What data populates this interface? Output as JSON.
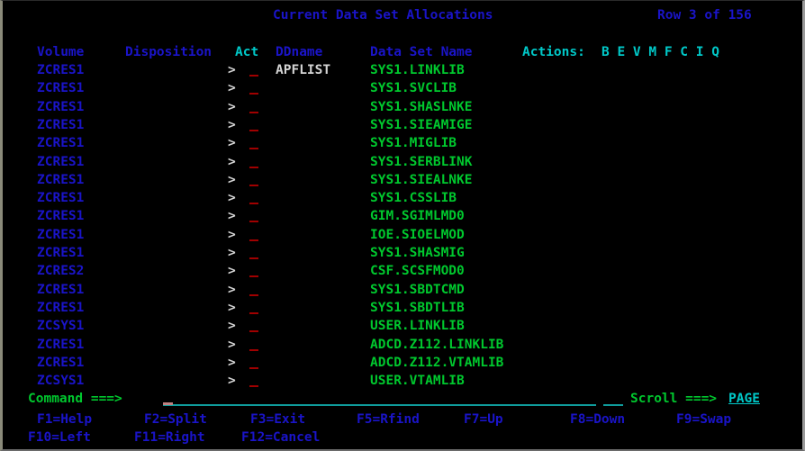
{
  "screen": {
    "title": "Current Data Set Allocations",
    "row_indicator": "Row 3 of 156",
    "colors": {
      "background": "#000000",
      "heading": "#1a14c8",
      "highlight": "#00c8c8",
      "data": "#00c82e",
      "input_marker": "#b00000",
      "neutral": "#d4d4d4"
    }
  },
  "columns": {
    "volume": "Volume",
    "disposition": "Disposition",
    "act": "Act",
    "ddname": "DDname",
    "data_set_name": "Data Set Name",
    "actions_label": "Actions:",
    "actions_keys": "B E V M F C I Q"
  },
  "rows": [
    {
      "volume": "ZCRES1",
      "disposition": ">",
      "act": "_",
      "ddname": "APFLIST",
      "dsn": "SYS1.LINKLIB"
    },
    {
      "volume": "ZCRES1",
      "disposition": ">",
      "act": "_",
      "ddname": "",
      "dsn": "SYS1.SVCLIB"
    },
    {
      "volume": "ZCRES1",
      "disposition": ">",
      "act": "_",
      "ddname": "",
      "dsn": "SYS1.SHASLNKE"
    },
    {
      "volume": "ZCRES1",
      "disposition": ">",
      "act": "_",
      "ddname": "",
      "dsn": "SYS1.SIEAMIGE"
    },
    {
      "volume": "ZCRES1",
      "disposition": ">",
      "act": "_",
      "ddname": "",
      "dsn": "SYS1.MIGLIB"
    },
    {
      "volume": "ZCRES1",
      "disposition": ">",
      "act": "_",
      "ddname": "",
      "dsn": "SYS1.SERBLINK"
    },
    {
      "volume": "ZCRES1",
      "disposition": ">",
      "act": "_",
      "ddname": "",
      "dsn": "SYS1.SIEALNKE"
    },
    {
      "volume": "ZCRES1",
      "disposition": ">",
      "act": "_",
      "ddname": "",
      "dsn": "SYS1.CSSLIB"
    },
    {
      "volume": "ZCRES1",
      "disposition": ">",
      "act": "_",
      "ddname": "",
      "dsn": "GIM.SGIMLMD0"
    },
    {
      "volume": "ZCRES1",
      "disposition": ">",
      "act": "_",
      "ddname": "",
      "dsn": "IOE.SIOELMOD"
    },
    {
      "volume": "ZCRES1",
      "disposition": ">",
      "act": "_",
      "ddname": "",
      "dsn": "SYS1.SHASMIG"
    },
    {
      "volume": "ZCRES2",
      "disposition": ">",
      "act": "_",
      "ddname": "",
      "dsn": "CSF.SCSFMOD0"
    },
    {
      "volume": "ZCRES1",
      "disposition": ">",
      "act": "_",
      "ddname": "",
      "dsn": "SYS1.SBDTCMD"
    },
    {
      "volume": "ZCRES1",
      "disposition": ">",
      "act": "_",
      "ddname": "",
      "dsn": "SYS1.SBDTLIB"
    },
    {
      "volume": "ZCSYS1",
      "disposition": ">",
      "act": "_",
      "ddname": "",
      "dsn": "USER.LINKLIB"
    },
    {
      "volume": "ZCRES1",
      "disposition": ">",
      "act": "_",
      "ddname": "",
      "dsn": "ADCD.Z112.LINKLIB"
    },
    {
      "volume": "ZCRES1",
      "disposition": ">",
      "act": "_",
      "ddname": "",
      "dsn": "ADCD.Z112.VTAMLIB"
    },
    {
      "volume": "ZCSYS1",
      "disposition": ">",
      "act": "_",
      "ddname": "",
      "dsn": "USER.VTAMLIB"
    }
  ],
  "command_line": {
    "label": "Command ===>",
    "value": "",
    "scroll_label": "Scroll ===>",
    "scroll_value": "PAGE"
  },
  "function_keys": [
    {
      "key": "F1=Help"
    },
    {
      "key": "F2=Split"
    },
    {
      "key": "F3=Exit"
    },
    {
      "key": "F5=Rfind"
    },
    {
      "key": "F7=Up"
    },
    {
      "key": "F8=Down"
    },
    {
      "key": "F9=Swap"
    },
    {
      "key": "F10=Left"
    },
    {
      "key": "F11=Right"
    },
    {
      "key": "F12=Cancel"
    }
  ]
}
